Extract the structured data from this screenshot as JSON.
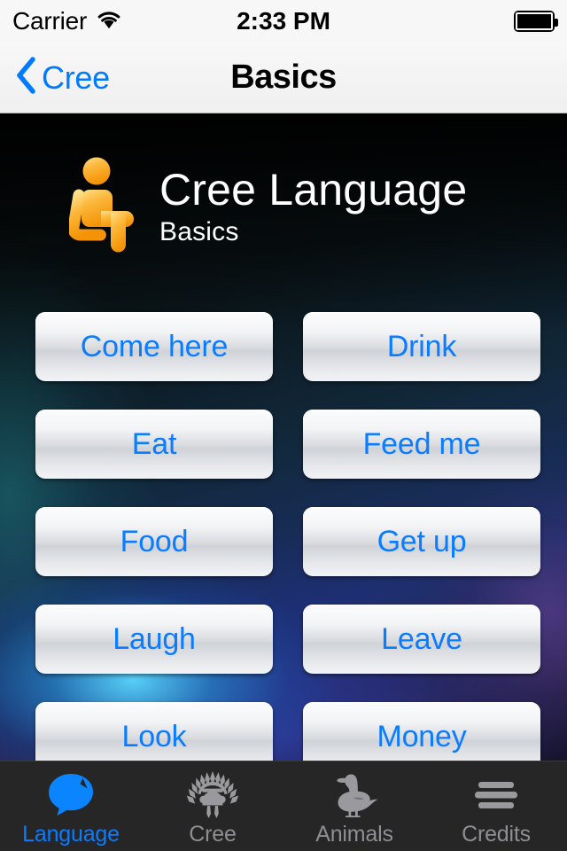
{
  "status_bar": {
    "carrier": "Carrier",
    "wifi_icon": "wifi-icon",
    "time": "2:33 PM",
    "battery_icon": "battery-full-icon"
  },
  "nav_bar": {
    "back_icon": "chevron-left-icon",
    "back_label": "Cree",
    "title": "Basics"
  },
  "header": {
    "logo_icon": "seated-person-icon",
    "title": "Cree Language",
    "subtitle": "Basics"
  },
  "buttons": [
    {
      "label": "Come here"
    },
    {
      "label": "Drink"
    },
    {
      "label": "Eat"
    },
    {
      "label": "Feed me"
    },
    {
      "label": "Food"
    },
    {
      "label": "Get up"
    },
    {
      "label": "Laugh"
    },
    {
      "label": "Leave"
    },
    {
      "label": "Look"
    },
    {
      "label": "Money"
    }
  ],
  "tab_bar": {
    "items": [
      {
        "label": "Language",
        "icon": "speech-bubble-icon",
        "active": true
      },
      {
        "label": "Cree",
        "icon": "headdress-icon",
        "active": false
      },
      {
        "label": "Animals",
        "icon": "duck-icon",
        "active": false
      },
      {
        "label": "Credits",
        "icon": "hamburger-menu-icon",
        "active": false
      }
    ]
  },
  "colors": {
    "accent_blue": "#0a7cff",
    "nav_blue": "#007aff",
    "logo_orange": "#f9a01b",
    "tab_inactive": "#8e8e93",
    "tab_bar_bg": "#262626"
  }
}
